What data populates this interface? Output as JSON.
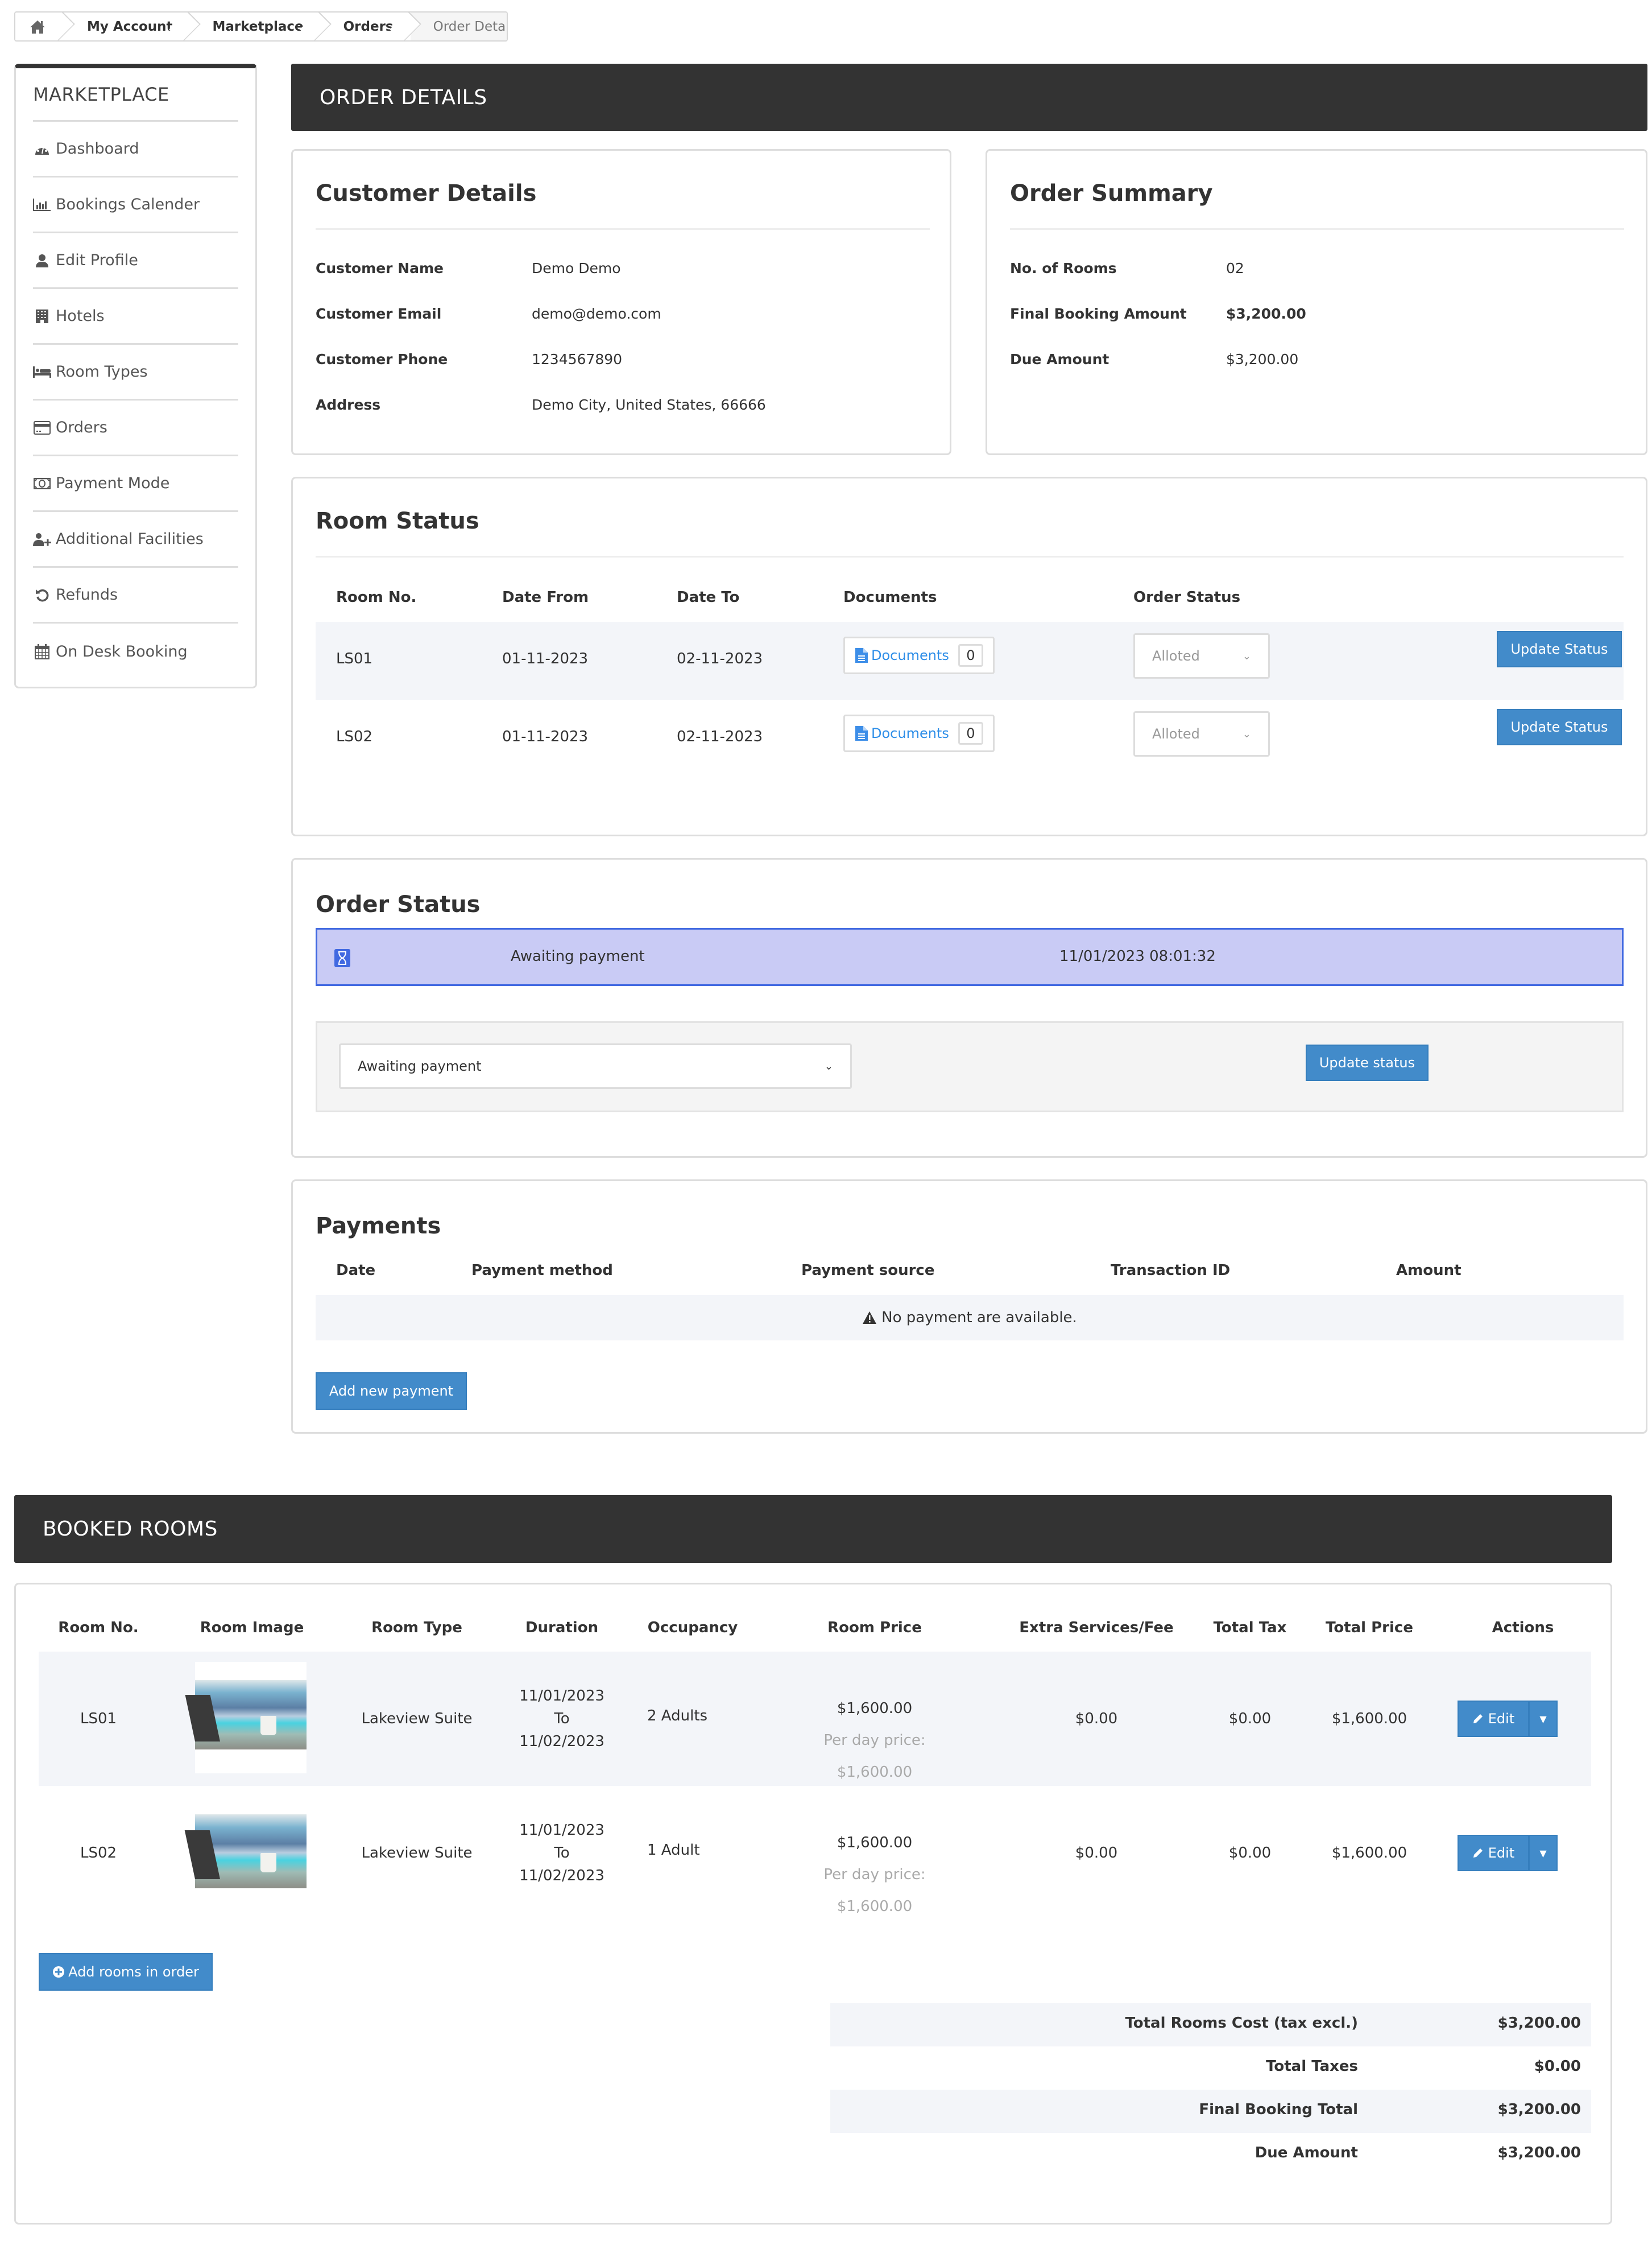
{
  "breadcrumb": {
    "items": [
      "My Account",
      "Marketplace",
      "Orders"
    ],
    "current": "Order Details"
  },
  "sidebar": {
    "title": "MARKETPLACE",
    "items": [
      {
        "label": "Dashboard",
        "icon": "dashboard-icon"
      },
      {
        "label": "Bookings Calender",
        "icon": "bar-chart-icon"
      },
      {
        "label": "Edit Profile",
        "icon": "user-icon"
      },
      {
        "label": "Hotels",
        "icon": "building-icon"
      },
      {
        "label": "Room Types",
        "icon": "bed-icon"
      },
      {
        "label": "Orders",
        "icon": "credit-card-icon"
      },
      {
        "label": "Payment Mode",
        "icon": "money-icon"
      },
      {
        "label": "Additional Facilities",
        "icon": "user-plus-icon"
      },
      {
        "label": "Refunds",
        "icon": "refresh-icon"
      },
      {
        "label": "On Desk Booking",
        "icon": "calendar-icon"
      }
    ]
  },
  "order_details": {
    "header": "ORDER DETAILS"
  },
  "customer": {
    "title": "Customer Details",
    "rows": [
      {
        "label": "Customer Name",
        "value": "Demo  Demo"
      },
      {
        "label": "Customer Email",
        "value": "demo@demo.com"
      },
      {
        "label": "Customer Phone",
        "value": "1234567890"
      },
      {
        "label": "Address",
        "value": "Demo City, United States, 66666"
      }
    ]
  },
  "order_summary": {
    "title": "Order Summary",
    "rows": [
      {
        "label": "No. of Rooms",
        "value": "02",
        "bold": false
      },
      {
        "label": "Final Booking Amount",
        "value": "$3,200.00",
        "bold": true
      },
      {
        "label": "Due Amount",
        "value": "$3,200.00",
        "bold": false
      }
    ]
  },
  "room_status": {
    "title": "Room Status",
    "columns": [
      "Room No.",
      "Date From",
      "Date To",
      "Documents",
      "Order Status"
    ],
    "rows": [
      {
        "room": "LS01",
        "from": "01-11-2023",
        "to": "02-11-2023",
        "docs_label": "Documents",
        "docs_count": "0",
        "status": "Alloted",
        "button": "Update Status"
      },
      {
        "room": "LS02",
        "from": "01-11-2023",
        "to": "02-11-2023",
        "docs_label": "Documents",
        "docs_count": "0",
        "status": "Alloted",
        "button": "Update Status"
      }
    ]
  },
  "order_status": {
    "title": "Order Status",
    "history": {
      "status": "Awaiting payment",
      "datetime": "11/01/2023 08:01:32",
      "color": "#c9cbf5",
      "border": "#4169e1"
    },
    "select_value": "Awaiting payment",
    "update_button": "Update status"
  },
  "payments": {
    "title": "Payments",
    "columns": [
      "Date",
      "Payment method",
      "Payment source",
      "Transaction ID",
      "Amount"
    ],
    "empty_message": "No payment are available.",
    "add_button": "Add new payment"
  },
  "booked_rooms": {
    "header": "BOOKED ROOMS",
    "columns": [
      "Room No.",
      "Room Image",
      "Room Type",
      "Duration",
      "Occupancy",
      "Room Price",
      "Extra Services/Fee",
      "Total Tax",
      "Total Price",
      "Actions"
    ],
    "rows": [
      {
        "room": "LS01",
        "type": "Lakeview Suite",
        "date_from": "11/01/2023",
        "to_label": "To",
        "date_to": "11/02/2023",
        "occupancy": "2 Adults",
        "price": "$1,600.00",
        "per_day": "Per day price: $1,600.00",
        "extra": "$0.00",
        "tax": "$0.00",
        "total": "$1,600.00",
        "edit": "Edit"
      },
      {
        "room": "LS02",
        "type": "Lakeview Suite",
        "date_from": "11/01/2023",
        "to_label": "To",
        "date_to": "11/02/2023",
        "occupancy": "1 Adult",
        "price": "$1,600.00",
        "per_day": "Per day price: $1,600.00",
        "extra": "$0.00",
        "tax": "$0.00",
        "total": "$1,600.00",
        "edit": "Edit"
      }
    ],
    "add_rooms_button": "Add rooms in order",
    "totals": [
      {
        "label": "Total Rooms Cost (tax excl.)",
        "value": "$3,200.00"
      },
      {
        "label": "Total Taxes",
        "value": "$0.00"
      },
      {
        "label": "Final Booking Total",
        "value": "$3,200.00"
      },
      {
        "label": "Due Amount",
        "value": "$3,200.00"
      }
    ]
  },
  "colors": {
    "primary_button": "#428bca",
    "dark_header": "#333333",
    "link_blue": "#2e8ee8",
    "row_shade": "#f3f5f9"
  }
}
